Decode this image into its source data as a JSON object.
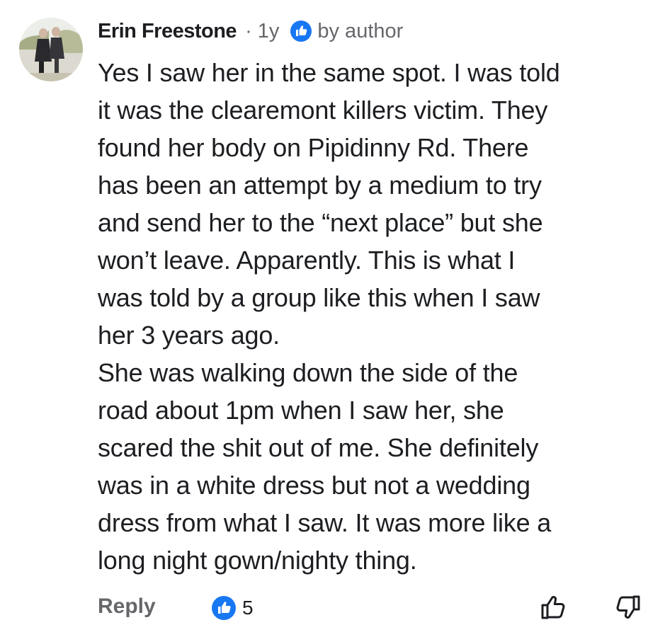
{
  "comment": {
    "author": "Erin Freestone",
    "separator": "·",
    "time": "1y",
    "badge": {
      "label": "by author",
      "icon": "thumbs-up-badge-icon",
      "color": "#1877f2"
    },
    "body": "Yes I saw her in the same spot. I was told\nit was the clearemont killers victim. They\nfound her body on Pipidinny Rd. There\nhas been an attempt by a medium to try\nand send her to the “next place” but she\nwon’t leave. Apparently. This is what I\nwas told by a group like this when I saw\nher 3 years ago.\nShe was walking down the side of the\nroad about 1pm when I saw her, she\nscared the shit out of me. She definitely\nwas in a white dress but not a wedding\ndress from what I saw. It was more like a\nlong night gown/nighty thing."
  },
  "actions": {
    "reply_label": "Reply",
    "like_count": "5",
    "reaction_icon": "like-reaction-icon",
    "upvote_icon": "thumbs-up-outline-icon",
    "downvote_icon": "thumbs-down-outline-icon"
  },
  "colors": {
    "text": "#1c1e21",
    "secondary": "#65676b",
    "brand": "#1877f2"
  }
}
